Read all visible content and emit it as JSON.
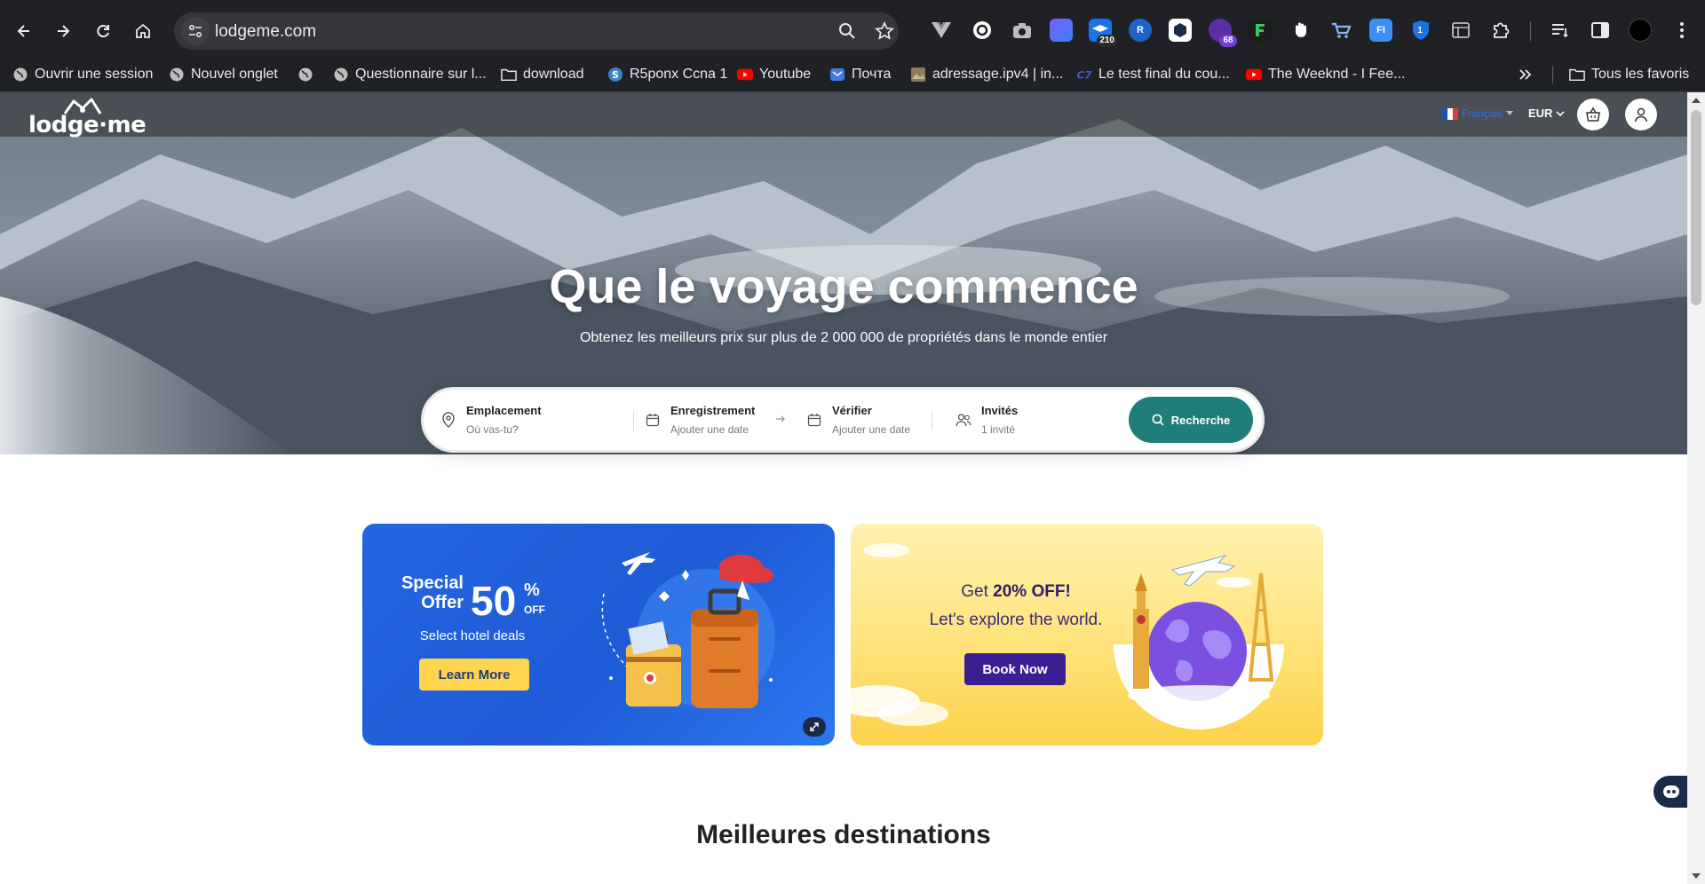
{
  "browser": {
    "url": "lodgeme.com",
    "extension_badges": {
      "ext3": "210",
      "ext6": "68",
      "ext11": "1"
    },
    "bookmarks": [
      "Ouvrir une session",
      "Nouvel onglet",
      "",
      "Questionnaire sur l...",
      "download",
      "R5ponx Ccna 1",
      "Youtube",
      "Почта",
      "adressage.ipv4 | in...",
      "Le test final du cou...",
      "The Weeknd - I Fee..."
    ],
    "all_bookmarks": "Tous les favoris"
  },
  "header": {
    "logo": "lodge·me",
    "language": "Français",
    "currency": "EUR"
  },
  "hero": {
    "title": "Que le voyage commence",
    "subtitle": "Obtenez les meilleurs prix sur plus de 2 000 000 de propriétés dans le monde entier"
  },
  "search": {
    "location_label": "Emplacement",
    "location_placeholder": "Où vas-tu?",
    "checkin_label": "Enregistrement",
    "checkin_value": "Ajouter une date",
    "checkout_label": "Vérifier",
    "checkout_value": "Ajouter une date",
    "guests_label": "Invités",
    "guests_value": "1 invité",
    "button": "Recherche"
  },
  "promo_blue": {
    "line1": "Special",
    "line2": "Offer",
    "big": "50",
    "pct": "%",
    "off": "OFF",
    "subtitle": "Select hotel deals",
    "button": "Learn More"
  },
  "promo_yellow": {
    "prefix": "Get ",
    "bold": "20% OFF!",
    "line2": "Let's explore the world.",
    "button": "Book Now"
  },
  "sections": {
    "top_destinations": "Meilleures destinations"
  },
  "colors": {
    "primary": "#1f7f78",
    "promo_blue": "#2566e0",
    "promo_yellow": "#ffe27a",
    "book_btn": "#3a1f93"
  }
}
